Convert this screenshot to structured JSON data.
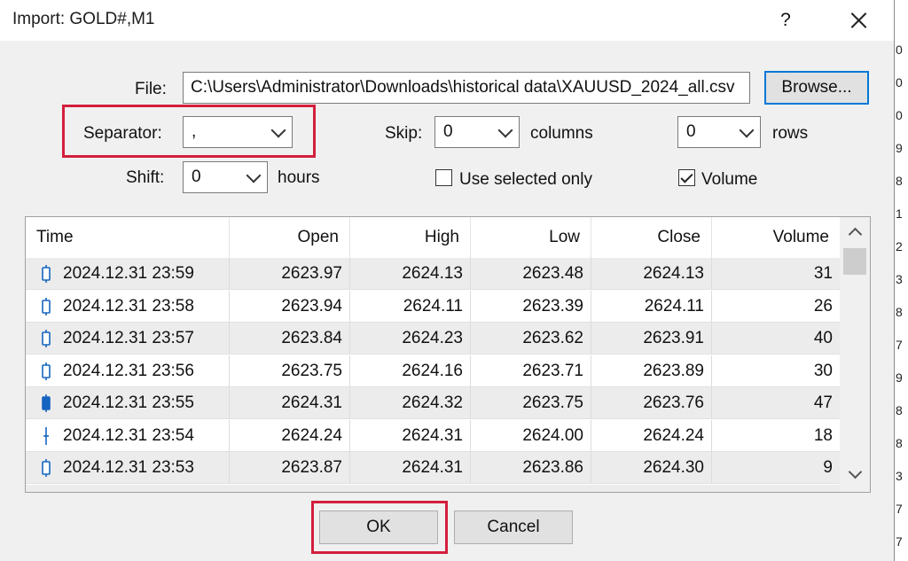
{
  "window": {
    "title": "Import: GOLD#,M1",
    "help_label": "?"
  },
  "background_digits": [
    "0",
    "0",
    "0",
    "9",
    "8",
    "1",
    "2",
    "3",
    "8",
    "7",
    "9",
    "8",
    "8",
    "3",
    "7",
    "7"
  ],
  "file": {
    "label": "File:",
    "value": "C:\\Users\\Administrator\\Downloads\\historical data\\XAUUSD_2024_all.csv",
    "browse_label": "Browse..."
  },
  "separator": {
    "label": "Separator:",
    "value": ","
  },
  "skip": {
    "label": "Skip:",
    "columns_value": "0",
    "columns_label": "columns",
    "rows_value": "0",
    "rows_label": "rows"
  },
  "shift": {
    "label": "Shift:",
    "value": "0",
    "unit_label": "hours"
  },
  "options": {
    "use_selected_only": {
      "label": "Use selected only",
      "checked": false
    },
    "volume": {
      "label": "Volume",
      "checked": true
    }
  },
  "table": {
    "columns": [
      "Time",
      "Open",
      "High",
      "Low",
      "Close",
      "Volume"
    ],
    "rows": [
      {
        "time": "2024.12.31 23:59",
        "open": "2623.97",
        "high": "2624.13",
        "low": "2623.48",
        "close": "2624.13",
        "volume": "31",
        "candle": "bull"
      },
      {
        "time": "2024.12.31 23:58",
        "open": "2623.94",
        "high": "2624.11",
        "low": "2623.39",
        "close": "2624.11",
        "volume": "26",
        "candle": "bull"
      },
      {
        "time": "2024.12.31 23:57",
        "open": "2623.84",
        "high": "2624.23",
        "low": "2623.62",
        "close": "2623.91",
        "volume": "40",
        "candle": "bull"
      },
      {
        "time": "2024.12.31 23:56",
        "open": "2623.75",
        "high": "2624.16",
        "low": "2623.71",
        "close": "2623.89",
        "volume": "30",
        "candle": "bull"
      },
      {
        "time": "2024.12.31 23:55",
        "open": "2624.31",
        "high": "2624.32",
        "low": "2623.75",
        "close": "2623.76",
        "volume": "47",
        "candle": "bear"
      },
      {
        "time": "2024.12.31 23:54",
        "open": "2624.24",
        "high": "2624.31",
        "low": "2624.00",
        "close": "2624.24",
        "volume": "18",
        "candle": "doji"
      },
      {
        "time": "2024.12.31 23:53",
        "open": "2623.87",
        "high": "2624.31",
        "low": "2623.86",
        "close": "2624.30",
        "volume": "9",
        "candle": "bull"
      }
    ]
  },
  "buttons": {
    "ok_label": "OK",
    "cancel_label": "Cancel"
  },
  "colors": {
    "highlight": "#d21f3c",
    "accent": "#0078d7",
    "candle": "#1565c0"
  }
}
